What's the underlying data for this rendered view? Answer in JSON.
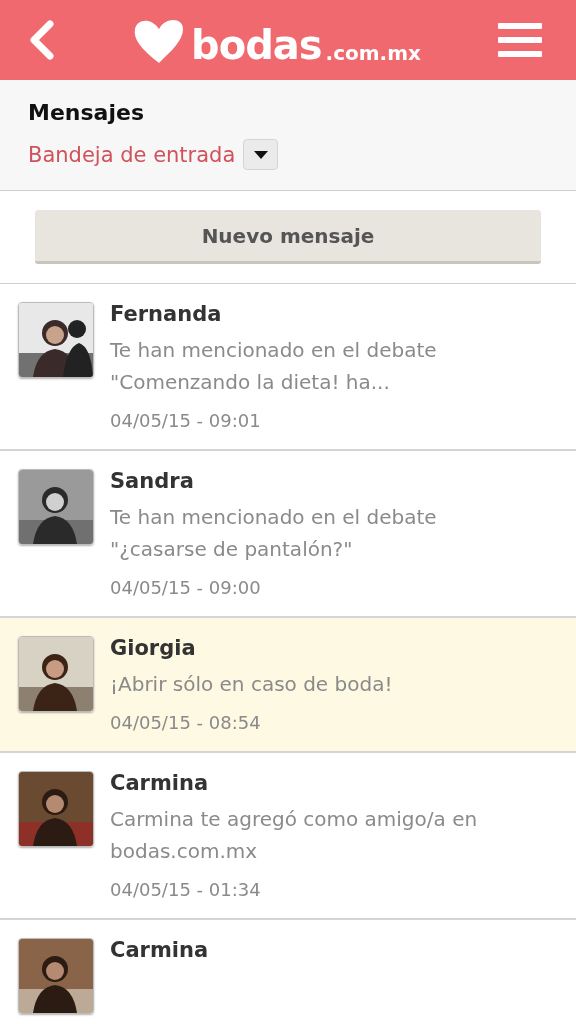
{
  "header": {
    "logo": {
      "name": "bodas",
      "domain": ".com.mx"
    }
  },
  "section": {
    "title": "Mensajes",
    "folder": "Bandeja de entrada"
  },
  "new_message_button": "Nuevo mensaje",
  "messages": [
    {
      "sender": "Fernanda",
      "text": "Te han mencionado en el debate \"Comenzando la dieta! ha...",
      "date": "04/05/15 - 09:01",
      "unread": false
    },
    {
      "sender": "Sandra",
      "text": "Te han mencionado en el debate \"¿casarse de pantalón?\"",
      "date": "04/05/15 - 09:00",
      "unread": false
    },
    {
      "sender": "Giorgia",
      "text": "¡Abrir sólo en caso de boda!",
      "date": "04/05/15 - 08:54",
      "unread": true
    },
    {
      "sender": "Carmina",
      "text": "Carmina te agregó como amigo/a en bodas.com.mx",
      "date": "04/05/15 - 01:34",
      "unread": false
    },
    {
      "sender": "Carmina",
      "unread": false
    }
  ]
}
